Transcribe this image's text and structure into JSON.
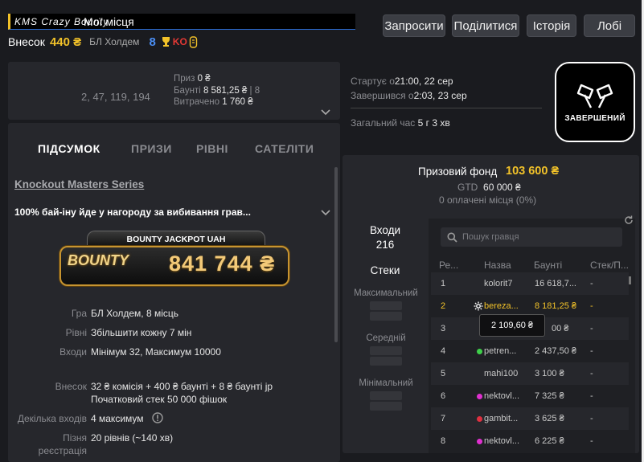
{
  "header": {
    "tournament_name": "KMS Crazy Bounty",
    "buyin_label": "Внесок",
    "buyin_value": "440 ₴",
    "game": "БЛ Холдем",
    "seats": "8",
    "ko_label": "KO"
  },
  "top_buttons": {
    "invite": "Запросити",
    "share": "Поділитися",
    "history": "Історія",
    "lobby": "Лобі"
  },
  "my_places": {
    "title": "Мої місця",
    "places": "2, 47, 119, 194",
    "prize_label": "Приз",
    "prize_value": "0 ₴",
    "bounty_label": "Баунті",
    "bounty_value": "8 581,25 ₴",
    "bounty_count": "8",
    "spent_label": "Витрачено",
    "spent_value": "1 760 ₴"
  },
  "times": {
    "started_label": "Стартує о",
    "started_value": "21:00, 22 сер",
    "finished_label": "Завершився о",
    "finished_value": "2:03, 23 сер",
    "total_label": "Загальний час",
    "total_value": "5 г 3 хв"
  },
  "status_badge": "ЗАВЕРШЕНИЙ",
  "tabs": [
    "ПІДСУМОК",
    "ПРИЗИ",
    "РІВНІ",
    "САТЕЛІТИ"
  ],
  "summary": {
    "series": "Knockout Masters Series",
    "bounty_note": "100% бай-іну йде у нагороду за вибивання грав...",
    "jackpot_title": "BOUNTY JACKPOT UAH",
    "jackpot_logo": "BOUNTY",
    "jackpot_value": "841 744 ₴",
    "info": [
      {
        "label": "Гра",
        "value": "БЛ Холдем, 8 місць"
      },
      {
        "label": "Рівні",
        "value": "Збільшити кожну 7 мін"
      },
      {
        "label": "Входи",
        "value": "Мінімум 32, Максимум 10000"
      },
      {
        "label": "Внесок",
        "value": "32 ₴ комісія + 400 ₴ баунті + 8 ₴ баунті jp",
        "value2": "Початковий стек 50 000 фішок"
      },
      {
        "label": "Декілька входів",
        "value": "4 максимум"
      },
      {
        "label": "Пізня",
        "label2": "реєстрація",
        "value": "20 рівнів (~140 хв)"
      }
    ]
  },
  "prize_pool": {
    "title": "Призовий фонд",
    "value": "103 600 ₴",
    "gtd_label": "GTD",
    "gtd_value": "60 000 ₴",
    "paid": "0 оплачені місця (0%)"
  },
  "entries": {
    "label": "Входи",
    "value": "216"
  },
  "stacks": {
    "label": "Стеки",
    "max": "Максимальний",
    "avg": "Середній",
    "min": "Мінімальний"
  },
  "players": {
    "search_placeholder": "Пошук гравця",
    "columns": [
      "Ре...",
      "Назва",
      "Баунті",
      "Стек/П..."
    ],
    "rows": [
      {
        "rank": "1",
        "name": "kolorit7",
        "bounty": "16 618,7...",
        "stack": "-"
      },
      {
        "rank": "2",
        "name": "bereza...",
        "bounty": "8 181,25 ₴",
        "stack": "-"
      },
      {
        "rank": "3",
        "name": "",
        "bounty": "00 ₴",
        "stack": "-"
      },
      {
        "rank": "4",
        "name": "petren...",
        "bounty": "2 437,50 ₴",
        "stack": "-"
      },
      {
        "rank": "5",
        "name": "mahi100",
        "bounty": "3 100 ₴",
        "stack": "-"
      },
      {
        "rank": "6",
        "name": "nektovl...",
        "bounty": "7 325 ₴",
        "stack": "-"
      },
      {
        "rank": "7",
        "name": "gambit...",
        "bounty": "3 625 ₴",
        "stack": "-"
      },
      {
        "rank": "8",
        "name": "nektovl...",
        "bounty": "6 225 ₴",
        "stack": "-"
      }
    ],
    "tooltip": "2 109,60 ₴"
  },
  "colors": {
    "accent": "#f2c229",
    "bg": "#1a1b1f",
    "panel": "#26272c",
    "online": "#3ecf4a",
    "status_pink": "#e030d0"
  }
}
